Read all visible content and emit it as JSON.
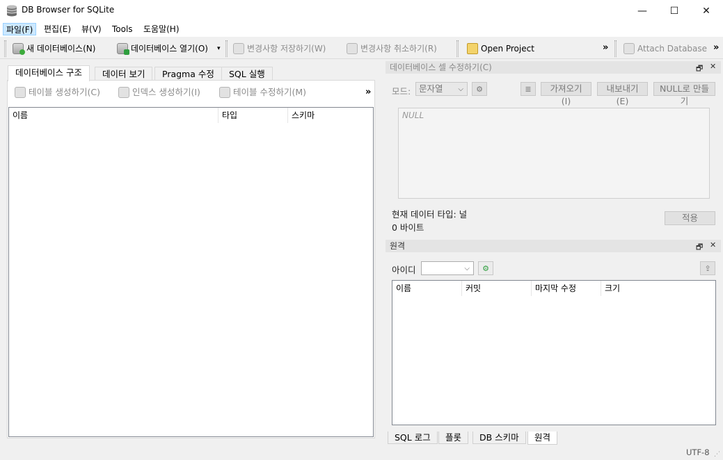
{
  "window": {
    "title": "DB Browser for SQLite",
    "minimize": "—",
    "maximize": "☐",
    "close": "✕"
  },
  "menu": {
    "items": [
      "파일(F)",
      "편집(E)",
      "뷰(V)",
      "Tools",
      "도움말(H)"
    ]
  },
  "toolbar": {
    "new_db": "새 데이터베이스(N)",
    "open_db": "데이터베이스 열기(O)",
    "write_changes": "변경사항 저장하기(W)",
    "revert_changes": "변경사항 취소하기(R)",
    "open_project": "Open Project",
    "overflow": "»",
    "attach_db": "Attach Database",
    "overflow2": "»",
    "dropdown_arrow": "▾"
  },
  "left_tabs": [
    "데이터베이스 구조",
    "데이터 보기",
    "Pragma 수정",
    "SQL 실행"
  ],
  "structure_toolbar": {
    "create_table": "테이블 생성하기(C)",
    "create_index": "인덱스 생성하기(I)",
    "modify_table": "테이블 수정하기(M)",
    "overflow": "»"
  },
  "structure_columns": [
    "이름",
    "타입",
    "스키마"
  ],
  "edit_cell": {
    "title": "데이터베이스 셀 수정하기(C)",
    "mode_label": "모드:",
    "mode_value": "문자열",
    "import": "가져오기(I)",
    "export": "내보내기(E)",
    "set_null": "NULL로 만들기",
    "placeholder": "NULL",
    "type_info": "현재 데이터 타입: 널",
    "size_info": "0 바이트",
    "apply": "적용"
  },
  "remote": {
    "title": "원격",
    "id_label": "아이디",
    "columns": [
      "이름",
      "커밋",
      "마지막 수정",
      "크기"
    ]
  },
  "bottom_tabs": [
    "SQL 로그",
    "플롯",
    "DB 스키마",
    "원격"
  ],
  "status": {
    "encoding": "UTF-8"
  },
  "colors": {
    "menu_active": "#cce8ff",
    "dock_title": "#e4e4e4",
    "disabled_text": "#8a8a8a"
  }
}
